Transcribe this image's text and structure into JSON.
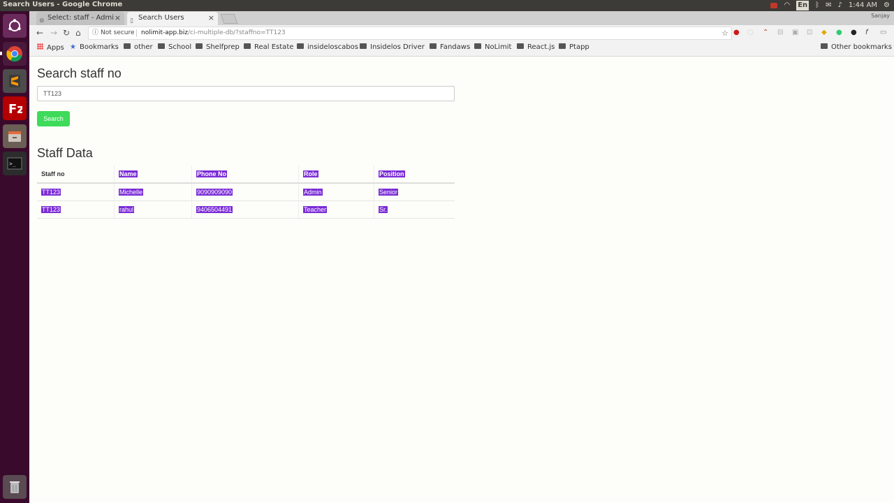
{
  "system": {
    "window_title": "Search Users - Google Chrome",
    "clock": "1:44 AM",
    "keyboard_layout": "En",
    "user_label": "Sanjay"
  },
  "launcher": {
    "items": [
      "ubuntu-dash",
      "chrome",
      "sublime-text",
      "filezilla",
      "files",
      "terminal",
      "trash"
    ]
  },
  "browser": {
    "tabs": [
      {
        "label": "Select: staff - Admi"
      },
      {
        "label": "Search Users"
      }
    ],
    "security_label": "Not secure",
    "url_host": "nolimit-app.biz",
    "url_path": "/ci-multiple-db/?staffno=TT123",
    "bookmarks": [
      {
        "label": "Apps"
      },
      {
        "label": "Bookmarks"
      },
      {
        "label": "other"
      },
      {
        "label": "School"
      },
      {
        "label": "Shelfprep"
      },
      {
        "label": "Real Estate"
      },
      {
        "label": "insideloscabos"
      },
      {
        "label": "Insidelos Driver"
      },
      {
        "label": "Fandaws"
      },
      {
        "label": "NoLimit"
      },
      {
        "label": "React.js"
      },
      {
        "label": "Ptapp"
      }
    ],
    "other_bookmarks": "Other bookmarks"
  },
  "page": {
    "search_heading": "Search staff no",
    "search_value": "TT123",
    "search_button": "Search",
    "data_heading": "Staff Data",
    "columns": [
      "Staff no",
      "Name",
      "Phone No",
      "Role",
      "Position"
    ],
    "rows": [
      [
        "TT123",
        "Michelle",
        "9090909090",
        "Admin",
        "Senior"
      ],
      [
        "TT123",
        "rahul",
        "9406504491",
        "Teacher",
        "Sr."
      ]
    ]
  },
  "colors": {
    "launcher_bg": "#3a0a2c",
    "search_button": "#3edb5a",
    "selection_highlight": "#7a2bd6"
  }
}
